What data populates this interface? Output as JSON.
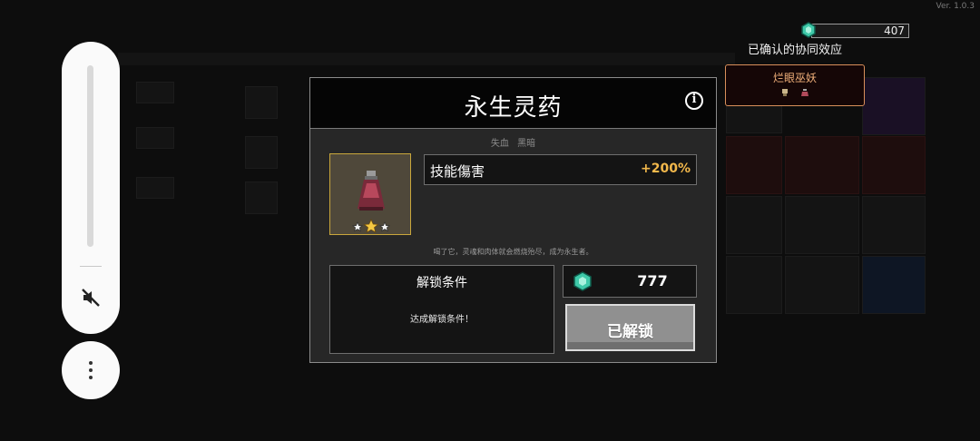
{
  "app": {
    "version": "Ver. 1.0.3"
  },
  "currency": {
    "icon": "gem-icon",
    "amount": "407"
  },
  "synergy": {
    "confirmed_label": "已确认的协同效应",
    "card_name": "烂眼巫妖",
    "card_color": "#d98f5a"
  },
  "side_controls": {
    "volume_icon": "mute-icon",
    "more_icon": "more-vertical-icon"
  },
  "modal": {
    "title": "永生灵药",
    "info_icon": "info-icon",
    "tags": [
      "失血",
      "黑暗"
    ],
    "item": {
      "icon": "potion-icon",
      "stars": 3,
      "frame_color": "#c9a73c"
    },
    "stat": {
      "name": "技能傷害",
      "value": "+200%",
      "value_color": "#f2b84b"
    },
    "description": "喝了它，灵魂和肉体就会燃烧殆尽，成为永生者。",
    "unlock": {
      "title": "解锁条件",
      "condition": "达成解锁条件！"
    },
    "cost": {
      "icon": "gem-icon",
      "value": "777"
    },
    "status_button": "已解锁"
  }
}
